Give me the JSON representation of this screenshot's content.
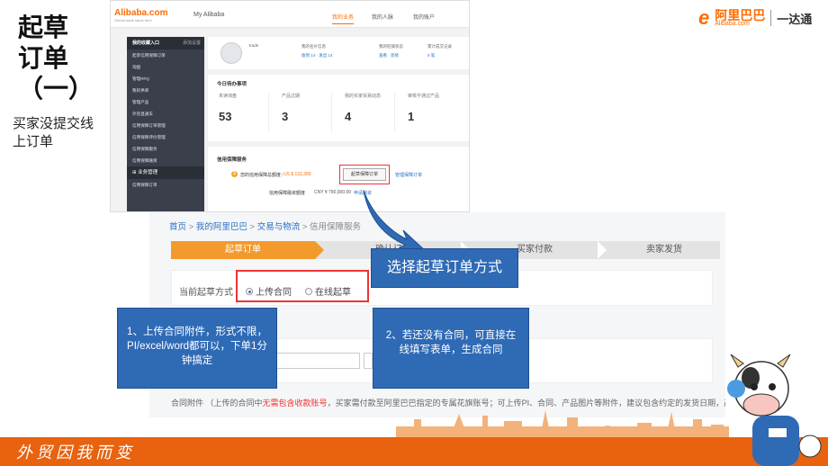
{
  "slide": {
    "title": "起草订单（一）",
    "subtitle": "买家没提交线上订单",
    "footer_slogan": "外贸因我而变"
  },
  "brand": {
    "symbol": "e",
    "cn": "阿里巴巴",
    "en": "Alibaba.com",
    "product": "一达通"
  },
  "shot1": {
    "logo": "Alibaba.com",
    "logo_tagline": "Global trade starts here",
    "my_alibaba": "My Alibaba",
    "nav": [
      "我的业务",
      "我的人脉",
      "我的账户"
    ],
    "sidebar_header": "我的收藏入口",
    "sidebar_header_action": "添加设置",
    "sidebar_items": [
      "起草信用保障订单",
      "询盘",
      "管理RFQ",
      "我的供单",
      "管理产品",
      "外贸直通车",
      "信用保障订单管理",
      "信用保障评价管理",
      "信用保障服务",
      "信用保障融资"
    ],
    "section_label": "业务管理",
    "section_item": "信用保障订单",
    "profile": {
      "name": "trade",
      "cols": [
        {
          "title": "我的名片信息",
          "value": "收到 14 · 发出 14"
        },
        {
          "title": "我的旺铺状态",
          "value": "查看 · 装修"
        },
        {
          "title": "累计成交记录",
          "value": "0 笔"
        }
      ]
    },
    "todo_title": "今日待办事项",
    "todo": [
      {
        "label": "未读询盘",
        "value": "53"
      },
      {
        "label": "产品过期",
        "value": "3"
      },
      {
        "label": "我的买家贸易动态",
        "value": "4"
      },
      {
        "label": "审核不通过产品",
        "value": "1"
      }
    ],
    "service_title": "信用保障服务",
    "limit_label": "您的信用保障总额度：",
    "limit_value": "US $ 132,300",
    "draft_button": "起草保障订单",
    "manage_link": "管理保障订单",
    "financing_label": "信用保障融资额度",
    "financing_value": "CNY ¥ 790,000.00",
    "apply_link": "申请融资"
  },
  "shot2": {
    "breadcrumb": [
      "首页",
      "我的阿里巴巴",
      "交易与物流",
      "信用保障服务"
    ],
    "steps": [
      "起草订单",
      "确认订单",
      "买家付款",
      "卖家发货"
    ],
    "mode_label": "当前起草方式",
    "option_upload": "上传合同",
    "option_online": "在线起草",
    "attach_label": "合同附件",
    "attach_prefix": "（上传的合同中",
    "attach_warning": "无需包含收款账号",
    "attach_suffix": "，买家需付款至阿里巴巴指定的专属花旗账号；可上传PI、合同、产品图片等附件，建议包含约定的发货日期，产品单"
  },
  "callouts": {
    "select": "选择起草订单方式",
    "upload": "1、上传合同附件，形式不限，PI/excel/word都可以，下单1分钟搞定",
    "online": "2、若还没有合同，可直接在线填写表单，生成合同"
  },
  "colors": {
    "accent": "#e8620f",
    "step_active": "#f39a2c",
    "callout": "#2f6ab5",
    "highlight": "#ee3333",
    "link": "#2b6fc7"
  }
}
